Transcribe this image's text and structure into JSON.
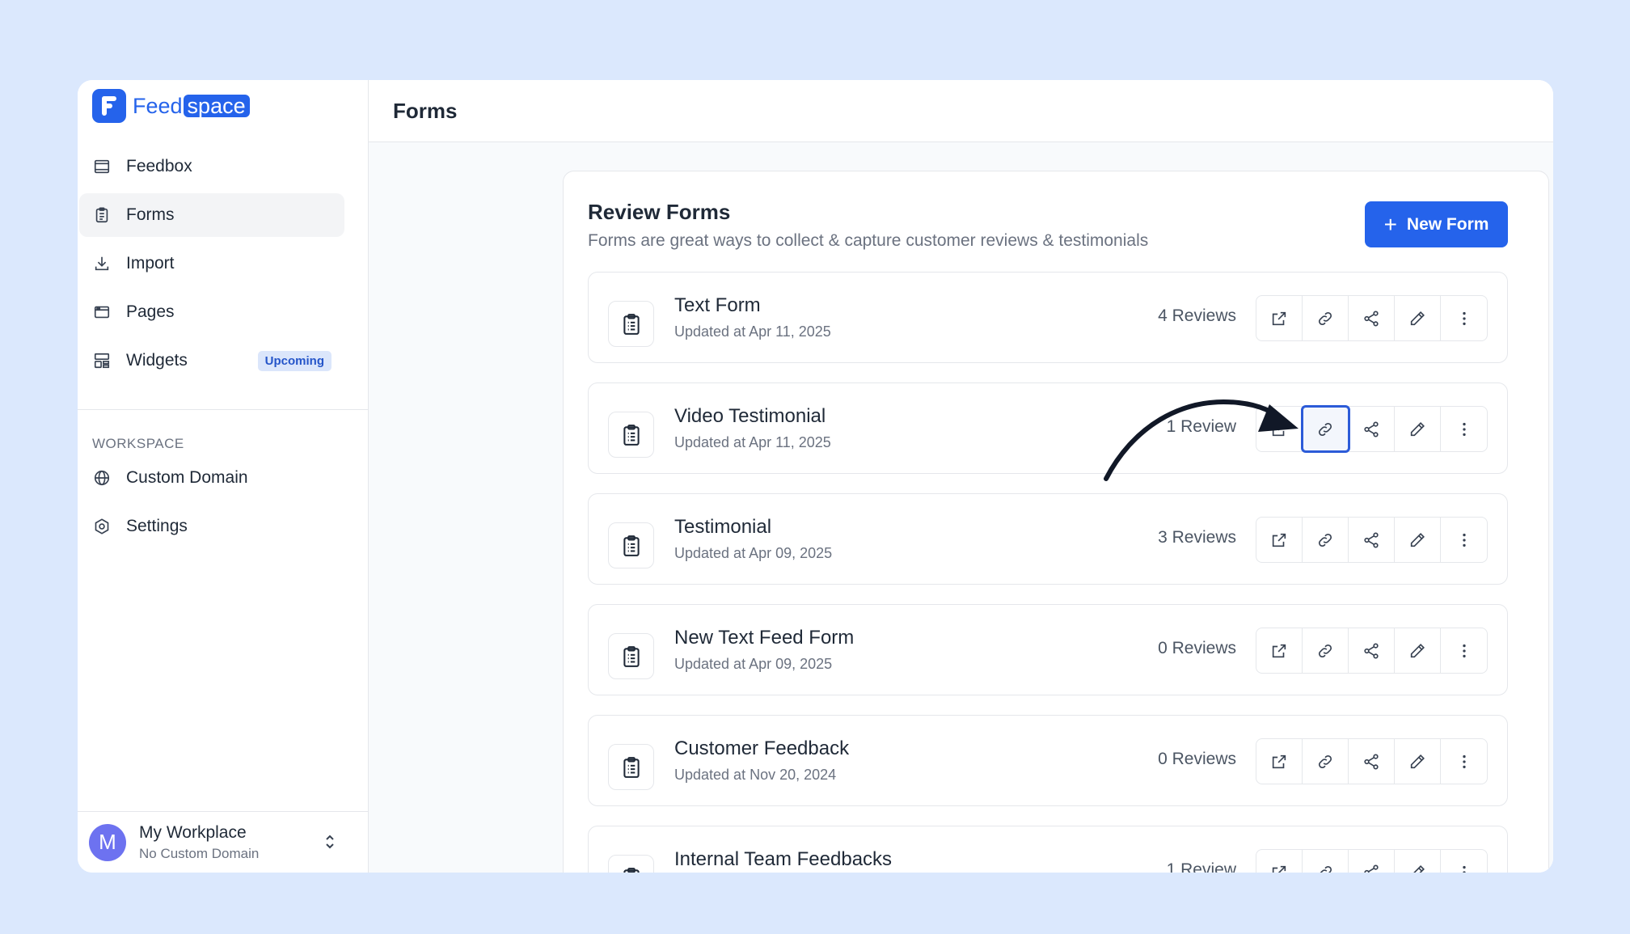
{
  "brand": {
    "name_part1": "Feed",
    "name_part2": "space",
    "accent": "#2563eb"
  },
  "sidebar": {
    "nav": [
      {
        "label": "Feedbox",
        "icon": "inbox-icon"
      },
      {
        "label": "Forms",
        "icon": "clipboard-icon",
        "active": true
      },
      {
        "label": "Import",
        "icon": "download-icon"
      },
      {
        "label": "Pages",
        "icon": "browser-window-icon"
      },
      {
        "label": "Widgets",
        "icon": "layout-icon",
        "badge": "Upcoming"
      }
    ],
    "section_label": "WORKSPACE",
    "workspace_nav": [
      {
        "label": "Custom Domain",
        "icon": "globe-icon"
      },
      {
        "label": "Settings",
        "icon": "gear-icon"
      }
    ],
    "workspace": {
      "avatar_letter": "M",
      "name": "My Workplace",
      "sub": "No Custom Domain"
    }
  },
  "header": {
    "title": "Forms"
  },
  "card": {
    "title": "Review Forms",
    "subtitle": "Forms are great ways to collect & capture customer reviews & testimonials",
    "new_button": "New Form"
  },
  "forms": [
    {
      "name": "Text Form",
      "updated": "Updated at Apr 11, 2025",
      "reviews": "4 Reviews"
    },
    {
      "name": "Video Testimonial",
      "updated": "Updated at Apr 11, 2025",
      "reviews": "1 Review",
      "highlighted_action": "copy-link"
    },
    {
      "name": "Testimonial",
      "updated": "Updated at Apr 09, 2025",
      "reviews": "3 Reviews"
    },
    {
      "name": "New Text Feed Form",
      "updated": "Updated at Apr 09, 2025",
      "reviews": "0 Reviews"
    },
    {
      "name": "Customer Feedback",
      "updated": "Updated at Nov 20, 2024",
      "reviews": "0 Reviews"
    },
    {
      "name": "Internal Team Feedbacks",
      "updated": "",
      "reviews": "1 Review"
    }
  ]
}
